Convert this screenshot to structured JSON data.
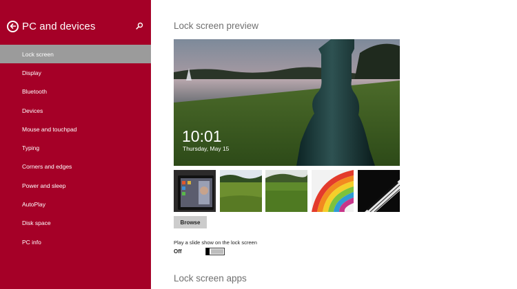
{
  "sidebar": {
    "title": "PC and devices",
    "items": [
      {
        "label": "Lock screen",
        "selected": true
      },
      {
        "label": "Display"
      },
      {
        "label": "Bluetooth"
      },
      {
        "label": "Devices"
      },
      {
        "label": "Mouse and touchpad"
      },
      {
        "label": "Typing"
      },
      {
        "label": "Corners and edges"
      },
      {
        "label": "Power and sleep"
      },
      {
        "label": "AutoPlay"
      },
      {
        "label": "Disk space"
      },
      {
        "label": "PC info"
      }
    ]
  },
  "main": {
    "preview_title": "Lock screen preview",
    "preview_time": "10:01",
    "preview_date": "Thursday, May 15",
    "browse_label": "Browse",
    "slideshow_label": "Play a slide show on the lock screen",
    "slideshow_state": "Off",
    "slideshow_on": false,
    "apps_title": "Lock screen apps"
  },
  "colors": {
    "accent": "#a50027",
    "selected_item": "#9b9b9b",
    "section_title": "#707070"
  }
}
